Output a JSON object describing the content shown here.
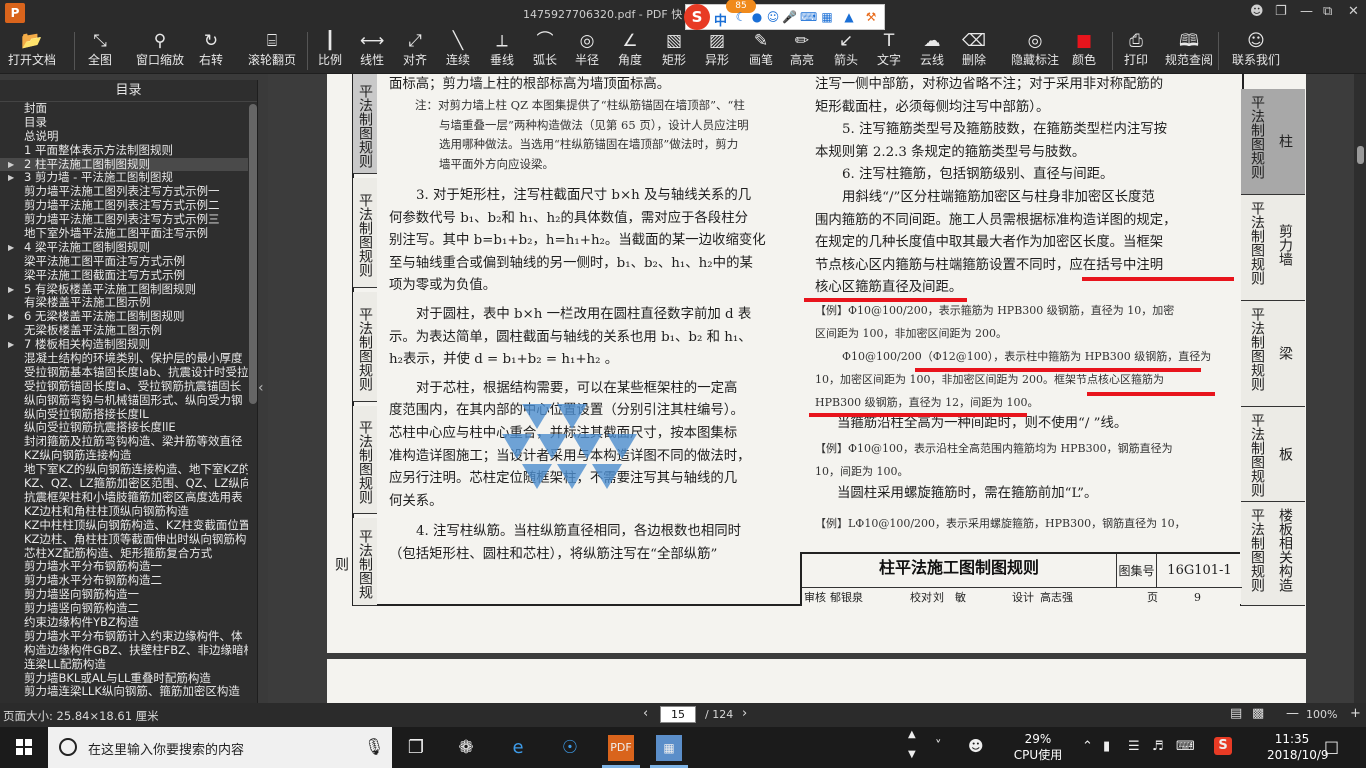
{
  "window": {
    "title": "1475927706320.pdf - PDF 快",
    "logo": "P",
    "controls": [
      "person-icon",
      "restore-icon",
      "minimize-icon",
      "maximize-icon",
      "close-icon"
    ]
  },
  "ime": {
    "logo": "S",
    "badge": "85",
    "lang": "中",
    "icons": [
      "moon-icon",
      "dot-icon",
      "smile-icon",
      "mic-icon",
      "keyboard-icon",
      "grid-icon",
      "shirt-icon",
      "wrench-icon"
    ]
  },
  "toolbar": [
    {
      "id": "open",
      "label": "打开文档",
      "icon": "folder-icon"
    },
    {
      "id": "fullview",
      "label": "全图",
      "icon": "fullscreen-icon"
    },
    {
      "id": "zoomwin",
      "label": "窗口缩放",
      "icon": "magnifier-icon"
    },
    {
      "id": "rotate",
      "label": "右转",
      "icon": "rotate-icon"
    },
    {
      "id": "scroll",
      "label": "滚轮翻页",
      "icon": "mouse-icon"
    },
    {
      "id": "ratio",
      "label": "比例",
      "icon": "ruler-icon"
    },
    {
      "id": "linear",
      "label": "线性",
      "icon": "linear-measure-icon"
    },
    {
      "id": "align",
      "label": "对齐",
      "icon": "align-icon"
    },
    {
      "id": "continuous",
      "label": "连续",
      "icon": "polyline-icon"
    },
    {
      "id": "perpendicular",
      "label": "垂线",
      "icon": "perpendicular-icon"
    },
    {
      "id": "arc",
      "label": "弧长",
      "icon": "arc-icon"
    },
    {
      "id": "radius",
      "label": "半径",
      "icon": "radius-icon"
    },
    {
      "id": "angle",
      "label": "角度",
      "icon": "angle-icon"
    },
    {
      "id": "rect",
      "label": "矩形",
      "icon": "rectangle-hatch-icon"
    },
    {
      "id": "shape",
      "label": "异形",
      "icon": "shape-hatch-icon"
    },
    {
      "id": "brush",
      "label": "画笔",
      "icon": "pen-icon"
    },
    {
      "id": "highlight",
      "label": "高亮",
      "icon": "highlighter-icon"
    },
    {
      "id": "arrow",
      "label": "箭头",
      "icon": "arrow-icon"
    },
    {
      "id": "text",
      "label": "文字",
      "icon": "text-icon"
    },
    {
      "id": "cloud",
      "label": "云线",
      "icon": "cloud-icon"
    },
    {
      "id": "delete",
      "label": "删除",
      "icon": "eraser-icon"
    },
    {
      "id": "hide",
      "label": "隐藏标注",
      "icon": "eye-off-icon"
    },
    {
      "id": "color",
      "label": "颜色",
      "icon": "color-swatch-icon"
    },
    {
      "id": "print",
      "label": "打印",
      "icon": "printer-icon"
    },
    {
      "id": "spec",
      "label": "规范查阅",
      "icon": "book-icon"
    },
    {
      "id": "contact",
      "label": "联系我们",
      "icon": "user-icon"
    }
  ],
  "swatch_color": "#e8141c",
  "sidebar": {
    "title": "目录",
    "items": [
      {
        "t": "封面",
        "arrow": false
      },
      {
        "t": "目录",
        "arrow": false
      },
      {
        "t": "总说明",
        "arrow": false
      },
      {
        "t": "1 平面整体表示方法制图规则",
        "arrow": false
      },
      {
        "t": "2 柱平法施工图制图规则",
        "arrow": true,
        "sel": true
      },
      {
        "t": "3 剪力墙 - 平法施工图制图规",
        "arrow": true
      },
      {
        "t": "剪力墙平法施工图列表注写方式示例一",
        "arrow": false
      },
      {
        "t": "剪力墙平法施工图列表注写方式示例二",
        "arrow": false
      },
      {
        "t": "剪力墙平法施工图列表注写方式示例三",
        "arrow": false
      },
      {
        "t": "地下室外墙平法施工图平面注写示例",
        "arrow": false
      },
      {
        "t": "4 梁平法施工图制图规则",
        "arrow": true
      },
      {
        "t": "梁平法施工图平面注写方式示例",
        "arrow": false
      },
      {
        "t": "梁平法施工图截面注写方式示例",
        "arrow": false
      },
      {
        "t": "5 有梁板楼盖平法施工图制图规则",
        "arrow": true
      },
      {
        "t": "有梁楼盖平法施工图示例",
        "arrow": false
      },
      {
        "t": "6 无梁楼盖平法施工图制图规则",
        "arrow": true
      },
      {
        "t": "无梁板楼盖平法施工图示例",
        "arrow": false
      },
      {
        "t": "7 楼板相关构造制图规则",
        "arrow": true
      },
      {
        "t": "混凝土结构的环境类别、保护层的最小厚度",
        "arrow": false
      },
      {
        "t": "受拉钢筋基本锚固长度lab、抗震设计时受拉",
        "arrow": false
      },
      {
        "t": "受拉钢筋锚固长度la、受拉钢筋抗震锚固长",
        "arrow": false
      },
      {
        "t": "纵向钢筋弯钩与机械锚固形式、纵向受力钢",
        "arrow": false
      },
      {
        "t": "纵向受拉钢筋搭接长度lL",
        "arrow": false
      },
      {
        "t": "纵向受拉钢筋抗震搭接长度llE",
        "arrow": false
      },
      {
        "t": "封闭箍筋及拉筋弯钩构造、梁并筋等效直径",
        "arrow": false
      },
      {
        "t": "KZ纵向钢筋连接构造",
        "arrow": false
      },
      {
        "t": "地下室KZ的纵向钢筋连接构造、地下室KZ的",
        "arrow": false
      },
      {
        "t": "KZ、QZ、LZ箍筋加密区范围、QZ、LZ纵向钢",
        "arrow": false
      },
      {
        "t": "抗震框架柱和小墙肢箍筋加密区高度选用表",
        "arrow": false
      },
      {
        "t": "KZ边柱和角柱柱顶纵向钢筋构造",
        "arrow": false
      },
      {
        "t": "KZ中柱柱顶纵向钢筋构造、KZ柱变截面位置",
        "arrow": false
      },
      {
        "t": "KZ边柱、角柱柱顶等截面伸出时纵向钢筋构",
        "arrow": false
      },
      {
        "t": "芯柱XZ配筋构造、矩形箍筋复合方式",
        "arrow": false
      },
      {
        "t": "剪力墙水平分布钢筋构造一",
        "arrow": false
      },
      {
        "t": "剪力墙水平分布钢筋构造二",
        "arrow": false
      },
      {
        "t": "剪力墙竖向钢筋构造一",
        "arrow": false
      },
      {
        "t": "剪力墙竖向钢筋构造二",
        "arrow": false
      },
      {
        "t": "约束边缘构件YBZ构造",
        "arrow": false
      },
      {
        "t": "剪力墙水平分布钢筋计入约束边缘构件、体",
        "arrow": false
      },
      {
        "t": "构造边缘构件GBZ、扶壁柱FBZ、非边缘暗柱",
        "arrow": false
      },
      {
        "t": "连梁LL配筋构造",
        "arrow": false
      },
      {
        "t": "剪力墙BKL或AL与LL重叠时配筋构造",
        "arrow": false
      },
      {
        "t": "剪力墙连梁LLK纵向钢筋、箍筋加密区构造",
        "arrow": false
      }
    ]
  },
  "doc": {
    "left_tabs": [
      "平法制图规则",
      "平法制图规则",
      "平法制图规则",
      "平法制图规则",
      "平法制图规则"
    ],
    "right_tabs": [
      {
        "v": "平法制图规则",
        "s": "柱"
      },
      {
        "v": "平法制图规则",
        "s": "剪力墙"
      },
      {
        "v": "平法制图规则",
        "s": "梁"
      },
      {
        "v": "平法制图规则",
        "s": "板"
      },
      {
        "v": "平法制图规则",
        "s": "楼板相关构造"
      }
    ],
    "left_lines": [
      "面标高；剪力墙上柱的根部标高为墙顶面标高。",
      "3. 对于矩形柱，注写柱截面尺寸 b×h 及与轴线关系的几",
      "何参数代号 b₁、b₂和 h₁、h₂的具体数值，需对应于各段柱分",
      "别注写。其中 b=b₁+b₂，h=h₁+h₂。当截面的某一边收缩变化",
      "至与轴线重合或偏到轴线的另一侧时，b₁、b₂、h₁、h₂中的某",
      "项为零或为负值。",
      "对于圆柱，表中 b×h 一栏改用在圆柱直径数字前加 d 表",
      "示。为表达简单，圆柱截面与轴线的关系也用 b₁、b₂ 和 h₁、",
      "h₂表示，并使 d = b₁+b₂ = h₁+h₂ 。",
      "对于芯柱，根据结构需要，可以在某些框架柱的一定高",
      "度范围内，在其内部的中心位置设置（分别引注其柱编号）。",
      "芯柱中心应与柱中心重合，并标注其截面尺寸，按本图集标",
      "准构造详图施工；当设计者采用与本构造详图不同的做法时，",
      "应另行注明。芯柱定位随框架柱，不需要注写其与轴线的几",
      "何关系。",
      "4. 注写柱纵筋。当柱纵筋直径相同，各边根数也相同时",
      "（包括矩形柱、圆柱和芯柱），将纵筋注写在“全部纵筋”"
    ],
    "left_note": [
      "注：对剪力墙上柱 QZ 本图集提供了“柱纵筋锚固在墙顶部”、“柱",
      "与墙重叠一层”两种构造做法（见第 65 页），设计人员应注明",
      "选用哪种做法。当选用“柱纵筋锚固在墙顶部”做法时，剪力",
      "墙平面外方向应设梁。"
    ],
    "right_lines": [
      "注写一侧中部筋，对称边省略不注；对于采用非对称配筋的",
      "矩形截面柱，必须每侧均注写中部筋）。",
      "5. 注写箍筋类型号及箍筋肢数，在箍筋类型栏内注写按",
      "本规则第 2.2.3 条规定的箍筋类型号与肢数。",
      "6. 注写柱箍筋，包括钢筋级别、直径与间距。",
      "用斜线“/”区分柱端箍筋加密区与柱身非加密区长度范",
      "围内箍筋的不同间距。施工人员需根据标准构造详图的规定，",
      "在规定的几种长度值中取其最大者作为加密区长度。当框架",
      "节点核心区内箍筋与柱端箍筋设置不同时，应在括号中注明",
      "核心区箍筋直径及间距。"
    ],
    "right_examples": [
      "【例】Φ10@100/200，表示箍筋为 HPB300 级钢筋，直径为 10，加密",
      "区间距为 100，非加密区间距为 200。",
      "Φ10@100/200（Φ12@100），表示柱中箍筋为 HPB300 级钢筋，直径为",
      "10，加密区间距为 100，非加密区间距为 200。框架节点核心区箍筋为",
      "HPB300 级钢筋，直径为 12，间距为 100。"
    ],
    "right_line2": "当箍筋沿柱全高为一种间距时，则不使用“/ ”线。",
    "right_ex2": [
      "【例】Φ10@100，表示沿柱全高范围内箍筋均为 HPB300，钢筋直径为",
      "10，间距为 100。"
    ],
    "right_line3": "当圆柱采用螺旋箍筋时，需在箍筋前加“L”。",
    "right_ex3": "【例】LΦ10@100/200，表示采用螺旋箍筋，HPB300，钢筋直径为 10，",
    "title_block": {
      "title": "柱平法施工图制图规则",
      "atlas_label": "图集号",
      "atlas_no": "16G101-1",
      "audit": "审核",
      "auditor": "郁银泉",
      "proof": "校对",
      "proofer": "刘　敏",
      "design": "设计",
      "designer": "高志强",
      "page_label": "页",
      "page_no": "9"
    }
  },
  "status": {
    "page_size": "页面大小: 25.84×18.61 厘米",
    "current_page": "15",
    "total": "/ 124",
    "zoom": "100%"
  },
  "taskbar": {
    "search_placeholder": "在这里输入你要搜索的内容",
    "cpu_percent": "29%",
    "cpu_label": "CPU使用",
    "time": "11:35",
    "date": "2018/10/9"
  }
}
